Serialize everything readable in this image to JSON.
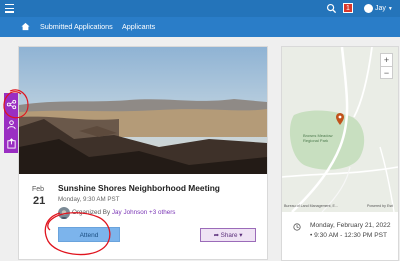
{
  "topbar": {
    "notification_count": "1",
    "user_name": "Jay"
  },
  "nav": {
    "links": [
      "Submitted Applications",
      "Applicants"
    ]
  },
  "event": {
    "month": "Feb",
    "day": "21",
    "title": "Sunshine Shores Neighborhood Meeting",
    "time": "Monday, 9:30 AM PST",
    "organized_prefix": "Organized By",
    "organizer": "Jay Johnson",
    "others": "+3 others",
    "attend_label": "Attend",
    "share_label": "Share"
  },
  "map": {
    "park_label": "Browns Meadow Regional Park",
    "attribution": "Bureau of Land Management, E...",
    "powered_by": "Powered by Esri"
  },
  "details": {
    "datetime": "Monday, February 21, 2022 • 9:30 AM - 12:30 PM PST"
  },
  "colors": {
    "topbar": "#2474ba",
    "navbar": "#2a7dc8",
    "sidebar": "#9a2ec2",
    "attend": "#7cb4ec",
    "annotation": "#e0141e"
  }
}
